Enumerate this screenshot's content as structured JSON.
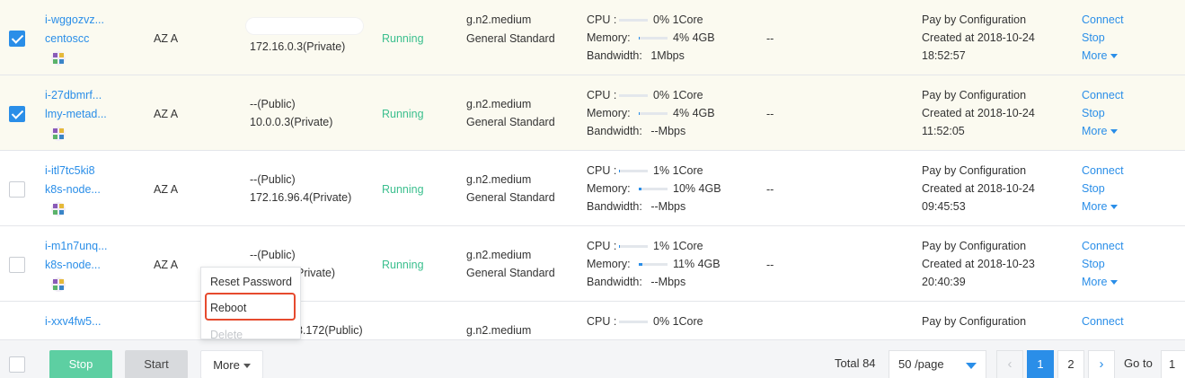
{
  "rows": [
    {
      "id": "i-wggozvz...",
      "name": "centoscc",
      "checked": true,
      "zone": "AZ A",
      "ip_public": "",
      "ip_private": "172.16.0.3(Private)",
      "status": "Running",
      "spec": "g.n2.medium",
      "family": "General Standard",
      "cpu_label": "CPU :",
      "cpu_pct": 0,
      "cpu_text": "0%",
      "cpu_cores": "1Core",
      "mem_label": "Memory:",
      "mem_pct": 4,
      "mem_text": "4%",
      "mem_size": "4GB",
      "bw_label": "Bandwidth:",
      "bw_value": "1Mbps",
      "extra": "--",
      "billing": "Pay by Configuration",
      "created": "Created at 2018-10-24",
      "time": "18:52:57",
      "connect": "Connect",
      "stop": "Stop",
      "more": "More"
    },
    {
      "id": "i-27dbmrf...",
      "name": "lmy-metad...",
      "checked": true,
      "zone": "AZ A",
      "ip_public": "--(Public)",
      "ip_private": "10.0.0.3(Private)",
      "status": "Running",
      "spec": "g.n2.medium",
      "family": "General Standard",
      "cpu_label": "CPU :",
      "cpu_pct": 0,
      "cpu_text": "0%",
      "cpu_cores": "1Core",
      "mem_label": "Memory:",
      "mem_pct": 4,
      "mem_text": "4%",
      "mem_size": "4GB",
      "bw_label": "Bandwidth:",
      "bw_value": "--Mbps",
      "extra": "--",
      "billing": "Pay by Configuration",
      "created": "Created at 2018-10-24",
      "time": "11:52:05",
      "connect": "Connect",
      "stop": "Stop",
      "more": "More"
    },
    {
      "id": "i-itl7tc5ki8",
      "name": "k8s-node...",
      "checked": false,
      "zone": "AZ A",
      "ip_public": "--(Public)",
      "ip_private": "172.16.96.4(Private)",
      "status": "Running",
      "spec": "g.n2.medium",
      "family": "General Standard",
      "cpu_label": "CPU :",
      "cpu_pct": 1,
      "cpu_text": "1%",
      "cpu_cores": "1Core",
      "mem_label": "Memory:",
      "mem_pct": 10,
      "mem_text": "10%",
      "mem_size": "4GB",
      "bw_label": "Bandwidth:",
      "bw_value": "--Mbps",
      "extra": "--",
      "billing": "Pay by Configuration",
      "created": "Created at 2018-10-24",
      "time": "09:45:53",
      "connect": "Connect",
      "stop": "Stop",
      "more": "More"
    },
    {
      "id": "i-m1n7unq...",
      "name": "k8s-node...",
      "checked": false,
      "zone": "AZ A",
      "ip_public": "--(Public)",
      "ip_private": "Private)",
      "status": "Running",
      "spec": "g.n2.medium",
      "family": "General Standard",
      "cpu_label": "CPU :",
      "cpu_pct": 1,
      "cpu_text": "1%",
      "cpu_cores": "1Core",
      "mem_label": "Memory:",
      "mem_pct": 11,
      "mem_text": "11%",
      "mem_size": "4GB",
      "bw_label": "Bandwidth:",
      "bw_value": "--Mbps",
      "extra": "--",
      "billing": "Pay by Configuration",
      "created": "Created at 2018-10-23",
      "time": "20:40:39",
      "connect": "Connect",
      "stop": "Stop",
      "more": "More"
    },
    {
      "id": "i-xxv4fw5...",
      "ip_public": "3.172(Public)",
      "spec": "g.n2.medium",
      "cpu_label": "CPU :",
      "cpu_pct": 0,
      "cpu_text": "0%",
      "cpu_cores": "1Core",
      "billing": "Pay by Configuration",
      "connect": "Connect"
    }
  ],
  "context_menu": {
    "reset_password": "Reset Password",
    "reboot": "Reboot",
    "delete": "Delete"
  },
  "footer": {
    "stop": "Stop",
    "start": "Start",
    "more": "More",
    "total": "Total 84",
    "page_size": "50 /page",
    "pages": [
      "1",
      "2"
    ],
    "current_page": "1",
    "goto_label": "Go to",
    "goto_value": "1"
  },
  "colors": {
    "accent": "#2a8ee8",
    "running": "#3bbf8e",
    "selected_row": "#fbfaf0",
    "highlight_border": "#e64a2e"
  },
  "icons": {
    "os": "linux-os-icon",
    "more_caret": "caret-down-icon",
    "prev": "chevron-left-icon",
    "next": "chevron-right-icon"
  }
}
